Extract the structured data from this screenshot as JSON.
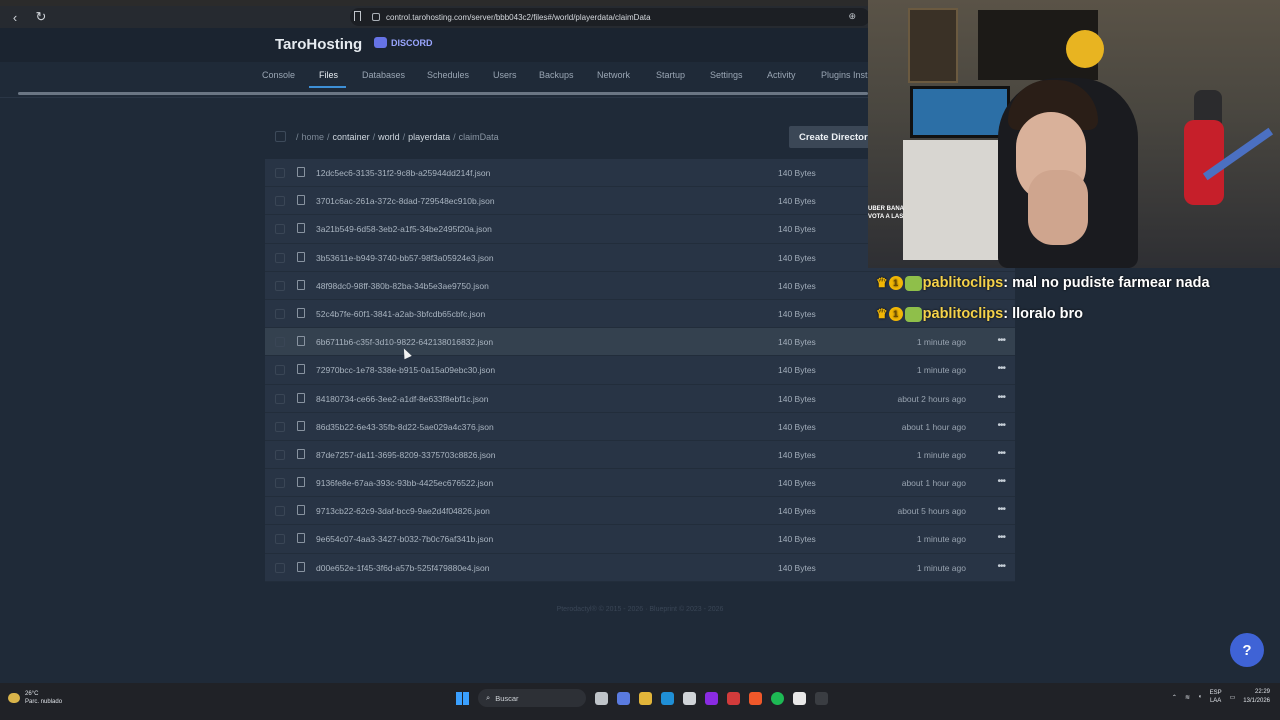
{
  "browser": {
    "url": "control.tarohosting.com/server/bbb043c2/files#/world/playerdata/claimData"
  },
  "app": {
    "brand": "TaroHosting",
    "discord_label": "DISCORD"
  },
  "tabs": [
    {
      "label": "Console"
    },
    {
      "label": "Files",
      "active": true
    },
    {
      "label": "Databases"
    },
    {
      "label": "Schedules"
    },
    {
      "label": "Users"
    },
    {
      "label": "Backups"
    },
    {
      "label": "Network"
    },
    {
      "label": "Startup"
    },
    {
      "label": "Settings"
    },
    {
      "label": "Activity"
    },
    {
      "label": "Plugins Inst"
    }
  ],
  "breadcrumb": {
    "root": "home",
    "segments": [
      "container",
      "world",
      "playerdata"
    ],
    "current": "claimData"
  },
  "toolbar": {
    "create_directory_label": "Create Director"
  },
  "files": [
    {
      "name": "12dc5ec6-3135-31f2-9c8b-a25944dd214f.json",
      "size": "140 Bytes",
      "modified": ""
    },
    {
      "name": "3701c6ac-261a-372c-8dad-729548ec910b.json",
      "size": "140 Bytes",
      "modified": ""
    },
    {
      "name": "3a21b549-6d58-3eb2-a1f5-34be2495f20a.json",
      "size": "140 Bytes",
      "modified": ""
    },
    {
      "name": "3b53611e-b949-3740-bb57-98f3a05924e3.json",
      "size": "140 Bytes",
      "modified": ""
    },
    {
      "name": "48f98dc0-98ff-380b-82ba-34b5e3ae9750.json",
      "size": "140 Bytes",
      "modified": ""
    },
    {
      "name": "52c4b7fe-60f1-3841-a2ab-3bfcdb65cbfc.json",
      "size": "140 Bytes",
      "modified": ""
    },
    {
      "name": "6b6711b6-c35f-3d10-9822-642138016832.json",
      "size": "140 Bytes",
      "modified": "1 minute ago"
    },
    {
      "name": "72970bcc-1e78-338e-b915-0a15a09ebc30.json",
      "size": "140 Bytes",
      "modified": "1 minute ago"
    },
    {
      "name": "84180734-ce66-3ee2-a1df-8e633f8ebf1c.json",
      "size": "140 Bytes",
      "modified": "about 2 hours ago"
    },
    {
      "name": "86d35b22-6e43-35fb-8d22-5ae029a4c376.json",
      "size": "140 Bytes",
      "modified": "about 1 hour ago"
    },
    {
      "name": "87de7257-da11-3695-8209-3375703c8826.json",
      "size": "140 Bytes",
      "modified": "1 minute ago"
    },
    {
      "name": "9136fe8e-67aa-393c-93bb-4425ec676522.json",
      "size": "140 Bytes",
      "modified": "about 1 hour ago"
    },
    {
      "name": "9713cb22-62c9-3daf-bcc9-9ae2d4f04826.json",
      "size": "140 Bytes",
      "modified": "about 5 hours ago"
    },
    {
      "name": "9e654c07-4aa3-3427-b032-7b0c76af341b.json",
      "size": "140 Bytes",
      "modified": "1 minute ago"
    },
    {
      "name": "d00e652e-1f45-3f6d-a57b-525f479880e4.json",
      "size": "140 Bytes",
      "modified": "1 minute ago"
    }
  ],
  "footer": "Pterodactyl® © 2015 - 2026 · Blueprint © 2023 - 2026",
  "webcam": {
    "mini_chat": [
      "UBER BANA",
      "VOTA A LAS"
    ]
  },
  "chat": [
    {
      "user": "pablitoclips",
      "message": "mal no pudiste farmear nada"
    },
    {
      "user": "pablitoclips",
      "message": "lloralo bro"
    }
  ],
  "help_button": "?",
  "taskbar": {
    "weather_temp": "26°C",
    "weather_desc": "Parc. nublado",
    "search_placeholder": "Buscar",
    "lang_top": "ESP",
    "lang_bottom": "LAA",
    "time": "22:29",
    "date": "13/1/2026"
  },
  "colors": {
    "accent": "#3d8fd6",
    "background": "#1f2a38",
    "row": "#283445",
    "help_button": "#3f63d6"
  }
}
